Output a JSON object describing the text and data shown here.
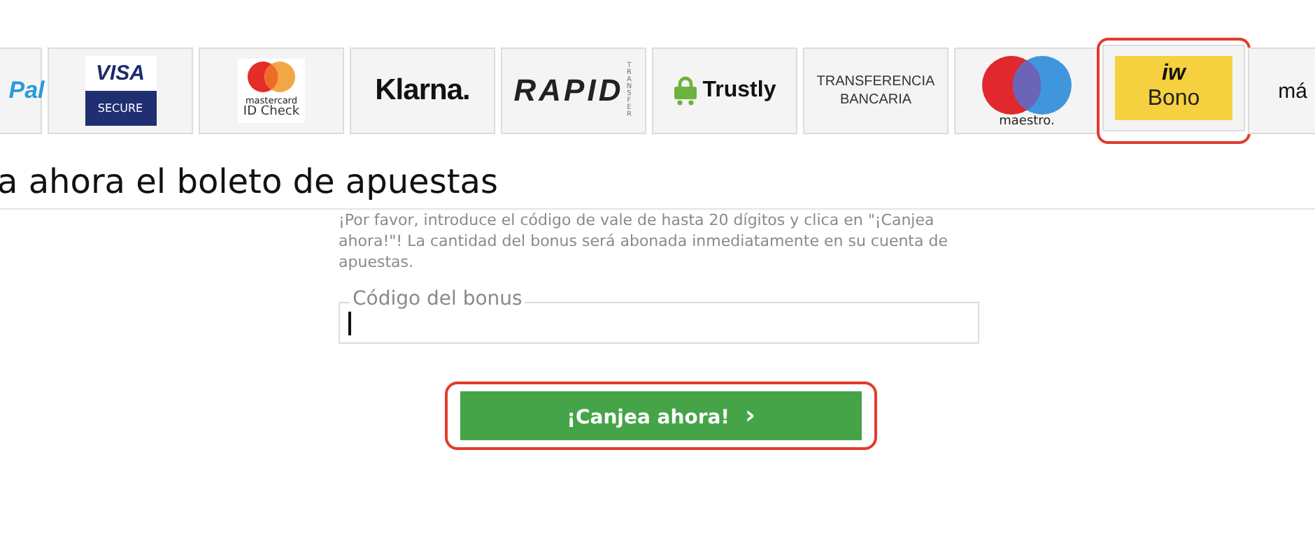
{
  "payment_methods": [
    {
      "kind": "paypal",
      "texts": [
        "Pal"
      ],
      "selected": false
    },
    {
      "kind": "visa",
      "texts": [
        "VISA",
        "SECURE"
      ],
      "selected": false
    },
    {
      "kind": "mastercard",
      "texts": [
        "mastercard",
        "ID Check"
      ],
      "selected": false
    },
    {
      "kind": "klarna",
      "texts": [
        "Klarna."
      ],
      "selected": false
    },
    {
      "kind": "rapid",
      "texts": [
        "RAPID",
        "TRANSFER"
      ],
      "selected": false
    },
    {
      "kind": "trustly",
      "texts": [
        "Trustly"
      ],
      "selected": false
    },
    {
      "kind": "bank",
      "texts": [
        "TRANSFERENCIA BANCARIA"
      ],
      "selected": false
    },
    {
      "kind": "maestro",
      "texts": [
        "maestro."
      ],
      "selected": false
    },
    {
      "kind": "bono",
      "texts": [
        "iw",
        "Bono"
      ],
      "selected": true
    },
    {
      "kind": "more",
      "texts": [
        "má"
      ],
      "selected": false
    }
  ],
  "heading": "a ahora el boleto de apuestas",
  "instructions": "¡Por favor, introduce el código de vale de hasta 20 dígitos y clica en \"¡Canjea ahora!\"! La cantidad del bonus será abonada inmediatamente en su cuenta de apuestas.",
  "bonus_field": {
    "label": "Código del bonus",
    "focused": true
  },
  "redeem_button": {
    "label": "¡Canjea ahora!",
    "icon": "›",
    "highlighted": true
  }
}
